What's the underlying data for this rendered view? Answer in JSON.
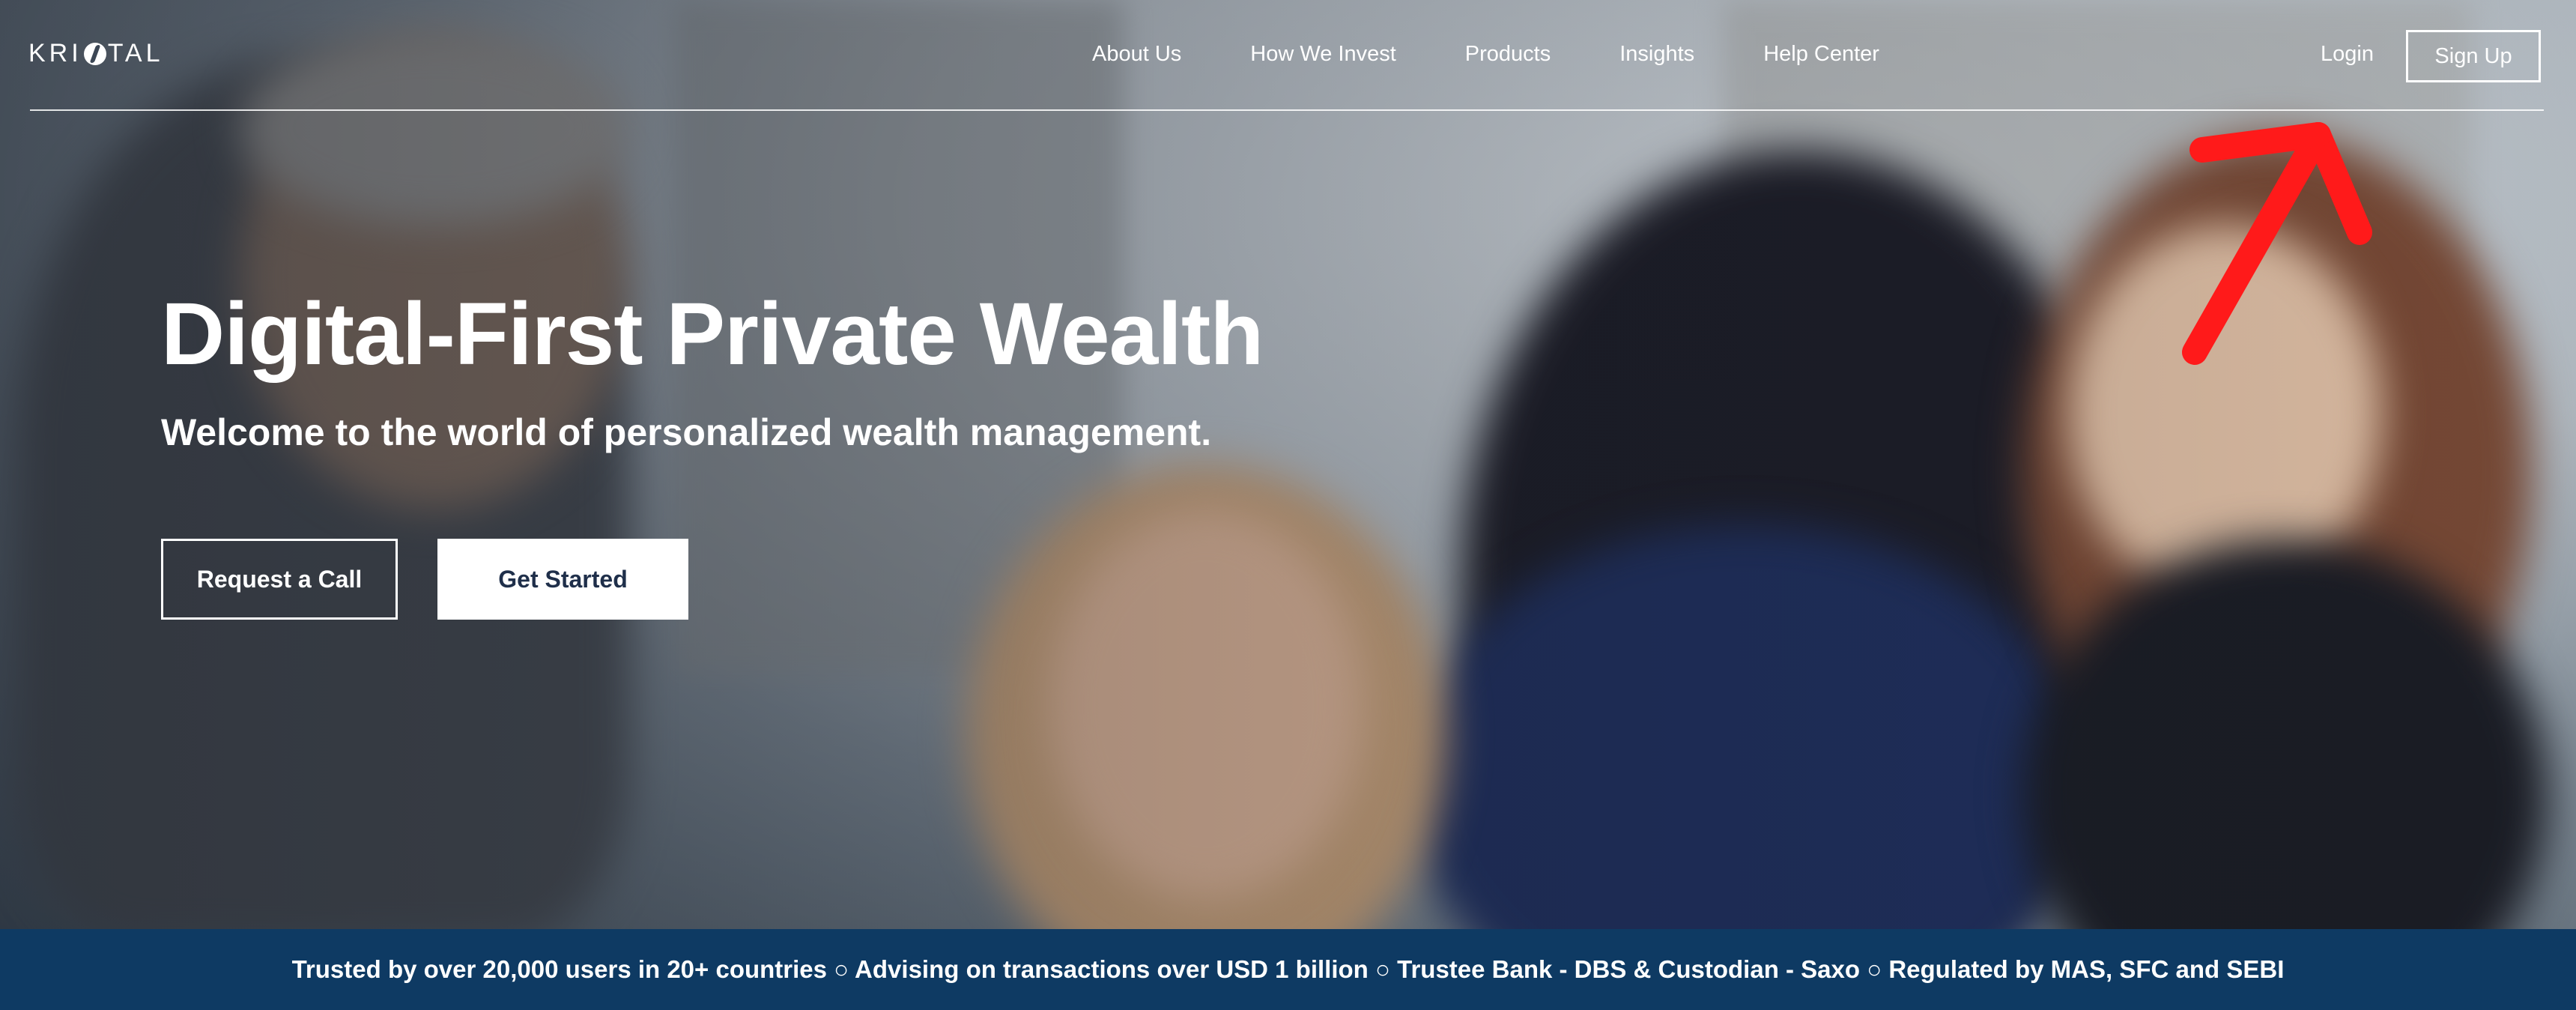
{
  "brand": {
    "logo_text_left": "KRI",
    "logo_text_right": "TAL"
  },
  "nav": {
    "links": [
      "About Us",
      "How We Invest",
      "Products",
      "Insights",
      "Help Center"
    ],
    "login": "Login",
    "signup": "Sign Up"
  },
  "hero": {
    "title": "Digital-First Private Wealth",
    "subtitle": "Welcome to the world of personalized wealth management.",
    "cta_secondary": "Request a Call",
    "cta_primary": "Get Started"
  },
  "trust_bar": {
    "text": "Trusted by over 20,000 users in 20+ countries ○ Advising on transactions over USD 1 billion ○ Trustee Bank - DBS & Custodian - Saxo ○ Regulated by MAS, SFC and SEBI"
  },
  "colors": {
    "trust_bar_bg": "#0e3a63",
    "primary_button_text": "#1f2f4a",
    "annotation_arrow": "#ff1a1a"
  }
}
